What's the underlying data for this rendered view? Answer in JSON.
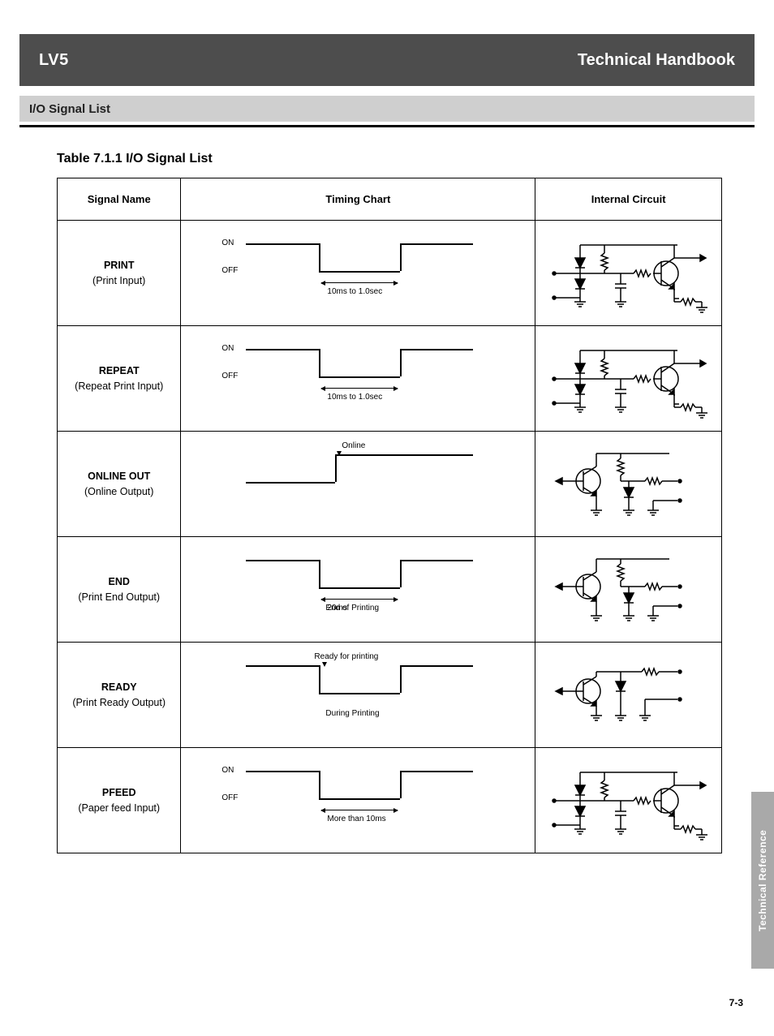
{
  "header": {
    "title": "LV5",
    "edition": "Technical Handbook"
  },
  "section": {
    "title": "I/O Signal List"
  },
  "table": {
    "title": "Table 7.1.1 I/O Signal List",
    "cols": {
      "c1": "Signal Name",
      "c2": "Timing Chart",
      "c3": "Internal Circuit"
    },
    "rows": [
      {
        "name_line1": "PRINT",
        "name_line2": "(Print Input)",
        "hi_label": "ON",
        "lo_label": "OFF",
        "time_label": "10ms to 1.0sec",
        "circuit_type": "input"
      },
      {
        "name_line1": "REPEAT",
        "name_line2": "(Repeat Print Input)",
        "hi_label": "ON",
        "lo_label": "OFF",
        "time_label": "10ms to 1.0sec",
        "circuit_type": "input"
      },
      {
        "name_line1": "ONLINE OUT",
        "name_line2": "(Online Output)",
        "hi_label": "",
        "lo_label": "",
        "action_top": "Online",
        "action_below": "",
        "time_label": "",
        "circuit_type": "output_single",
        "shape": "step_up"
      },
      {
        "name_line1": "END",
        "name_line2": "(Print End Output)",
        "hi_label": "",
        "lo_label": "",
        "action_below": "End of Printing",
        "time_label": "20ms",
        "circuit_type": "output_single",
        "shape": "pulse"
      },
      {
        "name_line1": "READY",
        "name_line2": "(Print Ready Output)",
        "hi_label": "",
        "lo_label": "",
        "action_top": "Ready for printing",
        "action_below": "During Printing",
        "time_label": "",
        "circuit_type": "output_plain",
        "shape": "pulse"
      },
      {
        "name_line1": "PFEED",
        "name_line2": "(Paper feed Input)",
        "hi_label": "ON",
        "lo_label": "OFF",
        "time_label": "More than 10ms",
        "circuit_type": "input"
      }
    ]
  },
  "sidetab": "Technical Reference",
  "pagenum": "7-3"
}
